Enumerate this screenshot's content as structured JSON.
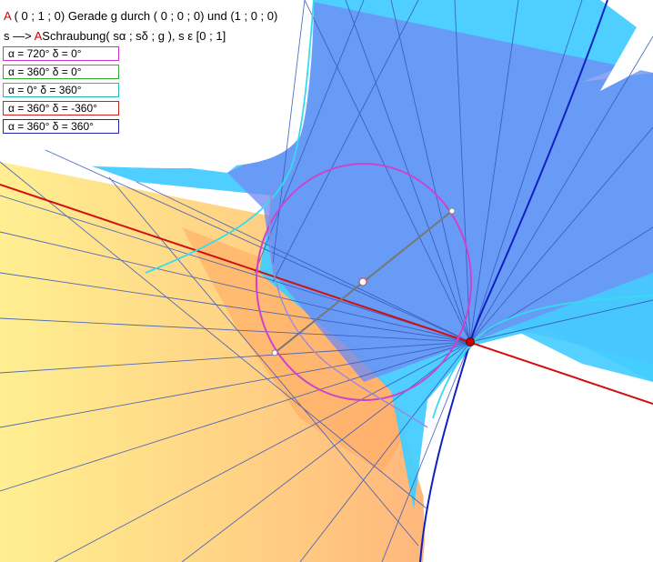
{
  "header": {
    "line1_point": "A",
    "line1_rest": " ( 0 ; 1 ; 0)   Gerade g durch ( 0 ; 0 ; 0) und (1 ; 0 ; 0)",
    "line2_prefix": "s —> ",
    "line2_point": "A",
    "line2_rest": "Schraubung( sα ; sδ ; g ), s ε  [0 ; 1]"
  },
  "legend": [
    {
      "label": "α = 720°   δ = 0°",
      "color": "#cc33cc"
    },
    {
      "label": "α = 360°   δ = 0°",
      "color": "#33aa33"
    },
    {
      "label": "α = 0°       δ = 360°",
      "color": "#22bbbb"
    },
    {
      "label": "α = 360°   δ = -360°",
      "color": "#cc2222"
    },
    {
      "label": "α = 360°   δ = 360°",
      "color": "#2222aa"
    }
  ],
  "colors": {
    "surface_cyan": "#44ccff",
    "surface_blue": "#6f8cf2",
    "surface_yellow": "#ffe97a",
    "surface_orange": "#ffbb66",
    "axis_red": "#d01010",
    "helix_blue": "#1020c0",
    "circle_magenta": "#cc44cc",
    "helix_cyan": "#33ddee",
    "point_red": "#cc0000"
  }
}
